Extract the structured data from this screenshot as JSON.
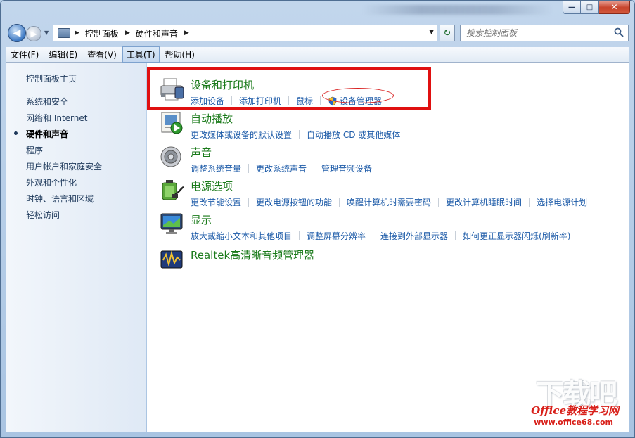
{
  "window": {
    "minimize_label": "—",
    "maximize_label": "□",
    "close_label": "✕"
  },
  "nav": {
    "back_label": "◀",
    "forward_label": "▶",
    "dropdown_label": "▼",
    "breadcrumbs": [
      "控制面板",
      "硬件和声音"
    ],
    "crumb_sep": "▶",
    "address_dropdown": "▼",
    "refresh_label": "↻",
    "search_placeholder": "搜索控制面板"
  },
  "menu": {
    "items": [
      "文件(F)",
      "编辑(E)",
      "查看(V)",
      "工具(T)",
      "帮助(H)"
    ],
    "active_index": 3
  },
  "sidebar": {
    "home": "控制面板主页",
    "items": [
      "系统和安全",
      "网络和 Internet",
      "硬件和声音",
      "程序",
      "用户帐户和家庭安全",
      "外观和个性化",
      "时钟、语言和区域",
      "轻松访问"
    ],
    "current_index": 2
  },
  "categories": [
    {
      "title": "设备和打印机",
      "icon": "printer-icon",
      "links": [
        "添加设备",
        "添加打印机",
        "鼠标",
        "设备管理器"
      ]
    },
    {
      "title": "自动播放",
      "icon": "autoplay-icon",
      "links": [
        "更改媒体或设备的默认设置",
        "自动播放 CD 或其他媒体"
      ]
    },
    {
      "title": "声音",
      "icon": "speaker-icon",
      "links": [
        "调整系统音量",
        "更改系统声音",
        "管理音频设备"
      ]
    },
    {
      "title": "电源选项",
      "icon": "power-icon",
      "links": [
        "更改节能设置",
        "更改电源按钮的功能",
        "唤醒计算机时需要密码",
        "更改计算机睡眠时间",
        "选择电源计划"
      ]
    },
    {
      "title": "显示",
      "icon": "monitor-icon",
      "links": [
        "放大或缩小文本和其他项目",
        "调整屏幕分辨率",
        "连接到外部显示器",
        "如何更正显示器闪烁(刷新率)"
      ]
    },
    {
      "title": "Realtek高清晰音频管理器",
      "icon": "realtek-audio-icon",
      "links": []
    }
  ],
  "watermark": {
    "large": "下载吧",
    "brand": "Office教程学习网",
    "url": "www.office68.com"
  },
  "colors": {
    "title_green": "#1a7a1a",
    "link_blue": "#1d5ba8",
    "highlight_red": "#e01010"
  }
}
